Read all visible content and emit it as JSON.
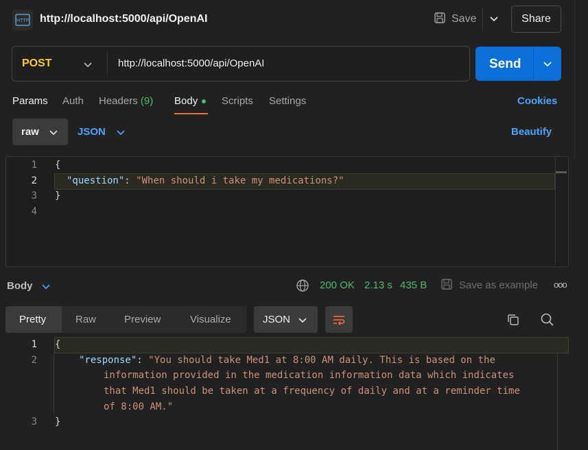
{
  "header": {
    "icon": "http-request-icon",
    "title": "http://localhost:5000/api/OpenAI",
    "save_label": "Save",
    "share_label": "Share"
  },
  "request": {
    "method": "POST",
    "url": "http://localhost:5000/api/OpenAI",
    "send_label": "Send"
  },
  "request_tabs": {
    "params": "Params",
    "auth": "Auth",
    "headers": "Headers",
    "headers_count": "(9)",
    "body": "Body",
    "scripts": "Scripts",
    "settings": "Settings",
    "cookies": "Cookies"
  },
  "body_options": {
    "mode": "raw",
    "format": "JSON",
    "beautify": "Beautify"
  },
  "request_body": {
    "line_numbers": [
      "1",
      "2",
      "3",
      "4"
    ],
    "open_brace": "{",
    "key": "\"question\"",
    "colon": ": ",
    "value": "\"When should i take my medications?\"",
    "close_brace": "}"
  },
  "response_bar": {
    "label": "Body",
    "status": "200 OK",
    "time": "2.13 s",
    "size": "435 B",
    "save_example": "Save as example",
    "more": "ooo"
  },
  "response_tabs": {
    "pretty": "Pretty",
    "raw": "Raw",
    "preview": "Preview",
    "visualize": "Visualize",
    "format": "JSON"
  },
  "response_body": {
    "ln1": "1",
    "ln2": "2",
    "ln3": "3",
    "open_brace": "{",
    "key": "\"response\"",
    "colon": ": ",
    "value_line1": "\"You should take Med1 at 8:00 AM daily. This is based on the",
    "value_line2": "information provided in the medication information data which indicates",
    "value_line3": "that Med1 should be taken at a frequency of daily and at a reminder time",
    "value_line4": "of 8:00 AM.\"",
    "close_brace": "}"
  },
  "colors": {
    "accent": "#0b6fd9",
    "method": "#ffcc33",
    "active_tab_underline": "#ff6c37",
    "status_ok": "#4dbb6a",
    "link": "#4aa3ff"
  }
}
